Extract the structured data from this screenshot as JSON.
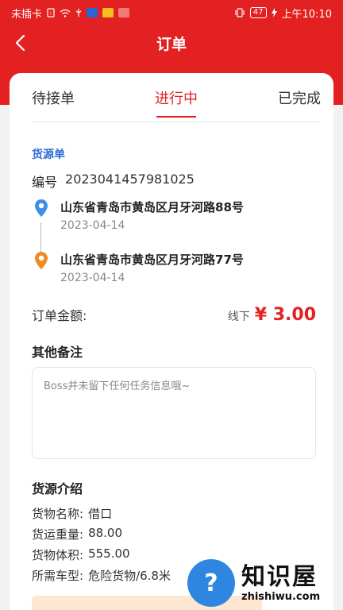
{
  "status_bar": {
    "carrier": "未插卡",
    "battery": "47",
    "time": "上午10:10"
  },
  "nav": {
    "title": "订单"
  },
  "tabs": [
    {
      "label": "待接单",
      "active": false
    },
    {
      "label": "进行中",
      "active": true
    },
    {
      "label": "已完成",
      "active": false
    }
  ],
  "order": {
    "section_label": "货源单",
    "number_key": "编号",
    "number": "2023041457981025",
    "route": [
      {
        "address": "山东省青岛市黄岛区月牙河路88号",
        "date": "2023-04-14",
        "pin_color": "#3f8fe8"
      },
      {
        "address": "山东省青岛市黄岛区月牙河路77号",
        "date": "2023-04-14",
        "pin_color": "#f08a24"
      }
    ],
    "amount_label": "订单金额:",
    "amount_mode": "线下",
    "amount_value": "¥ 3.00"
  },
  "remarks": {
    "title": "其他备注",
    "text": "Boss并未留下任何任务信息哦~"
  },
  "intro": {
    "title": "货源介绍",
    "rows": [
      {
        "key": "货物名称:",
        "value": "借口"
      },
      {
        "key": "货运重量:",
        "value": "88.00"
      },
      {
        "key": "货物体积:",
        "value": "555.00"
      },
      {
        "key": "所需车型:",
        "value": "危险货物/6.8米"
      }
    ]
  },
  "watermark": {
    "cn": "知识屋",
    "en": "zhishiwu.com"
  },
  "colors": {
    "brand_red": "#e42122",
    "link_blue": "#2f6cd8"
  }
}
